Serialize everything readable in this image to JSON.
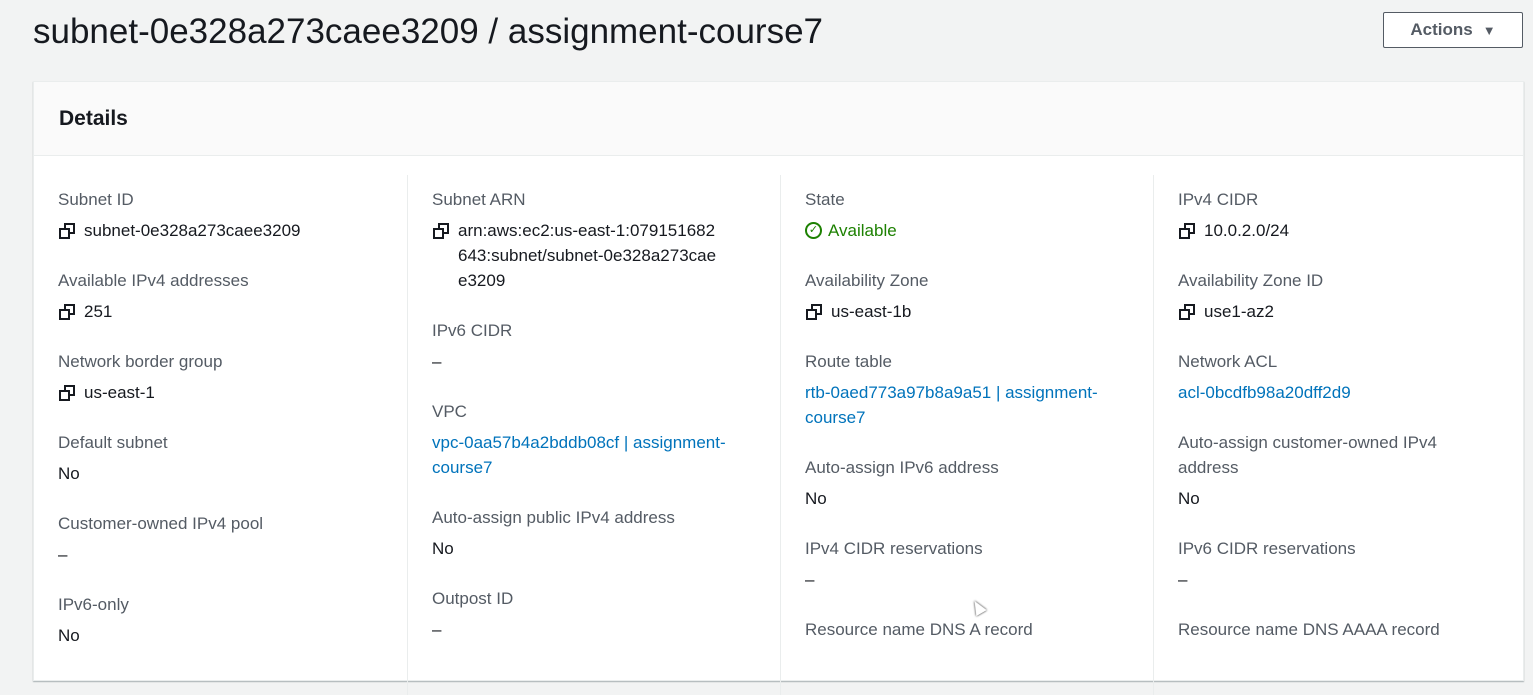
{
  "header": {
    "title": "subnet-0e328a273caee3209 / assignment-course7",
    "actions_label": "Actions"
  },
  "panel": {
    "title": "Details"
  },
  "fields": {
    "subnet_id": {
      "label": "Subnet ID",
      "value": "subnet-0e328a273caee3209"
    },
    "available_ipv4": {
      "label": "Available IPv4 addresses",
      "value": "251"
    },
    "network_border_group": {
      "label": "Network border group",
      "value": "us-east-1"
    },
    "default_subnet": {
      "label": "Default subnet",
      "value": "No"
    },
    "customer_owned_pool": {
      "label": "Customer-owned IPv4 pool",
      "value": "–"
    },
    "ipv6_only": {
      "label": "IPv6-only",
      "value": "No"
    },
    "subnet_arn": {
      "label": "Subnet ARN",
      "value": "arn:aws:ec2:us-east-1:079151682643:subnet/subnet-0e328a273caee3209"
    },
    "ipv6_cidr": {
      "label": "IPv6 CIDR",
      "value": "–"
    },
    "vpc": {
      "label": "VPC",
      "value": "vpc-0aa57b4a2bddb08cf | assignment-course7"
    },
    "auto_assign_public_ipv4": {
      "label": "Auto-assign public IPv4 address",
      "value": "No"
    },
    "outpost_id": {
      "label": "Outpost ID",
      "value": "–"
    },
    "state": {
      "label": "State",
      "value": "Available"
    },
    "availability_zone": {
      "label": "Availability Zone",
      "value": "us-east-1b"
    },
    "route_table": {
      "label": "Route table",
      "value": "rtb-0aed773a97b8a9a51 | assignment-course7"
    },
    "auto_assign_ipv6": {
      "label": "Auto-assign IPv6 address",
      "value": "No"
    },
    "ipv4_cidr_reservations": {
      "label": "IPv4 CIDR reservations",
      "value": "–"
    },
    "dns_a_record": {
      "label": "Resource name DNS A record",
      "value": ""
    },
    "ipv4_cidr": {
      "label": "IPv4 CIDR",
      "value": "10.0.2.0/24"
    },
    "availability_zone_id": {
      "label": "Availability Zone ID",
      "value": "use1-az2"
    },
    "network_acl": {
      "label": "Network ACL",
      "value": "acl-0bcdfb98a20dff2d9"
    },
    "auto_assign_customer_owned": {
      "label": "Auto-assign customer-owned IPv4 address",
      "value": "No"
    },
    "ipv6_cidr_reservations": {
      "label": "IPv6 CIDR reservations",
      "value": "–"
    },
    "dns_aaaa_record": {
      "label": "Resource name DNS AAAA record",
      "value": ""
    }
  },
  "colors": {
    "link": "#0073bb",
    "status_available": "#1d8102",
    "text": "#16191f",
    "label": "#545b64"
  },
  "icons": [
    "copy-icon",
    "status-success-icon",
    "caret-down-icon"
  ]
}
